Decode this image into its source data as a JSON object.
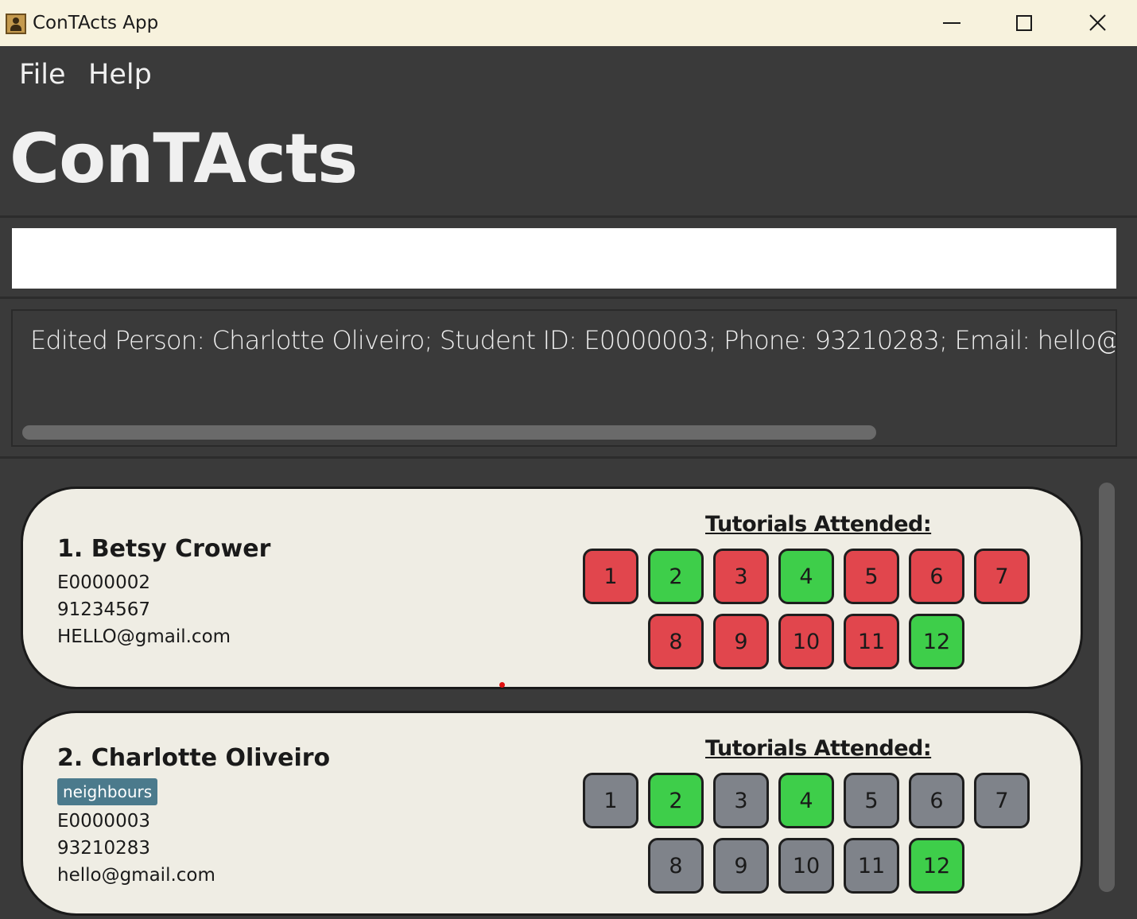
{
  "window": {
    "title": "ConTActs App",
    "controls": {
      "minimize": "minimize-icon",
      "maximize": "maximize-icon",
      "close": "close-icon"
    }
  },
  "menu": {
    "file": "File",
    "help": "Help"
  },
  "heading": "ConTActs",
  "command": {
    "value": "",
    "placeholder": ""
  },
  "result": {
    "text": "Edited Person: Charlotte Oliveiro; Student ID: E0000003; Phone: 93210283; Email: hello@gmail."
  },
  "colors": {
    "attended": "#3ece4a",
    "absent": "#e1464d",
    "unmarked": "#7f838a",
    "tag": "#4b7a8c",
    "card": "#efede4"
  },
  "persons": [
    {
      "name": "1. Betsy Crower",
      "tags": [],
      "student_id": "E0000002",
      "phone": "91234567",
      "email": "HELLO@gmail.com",
      "tutorials_heading": "Tutorials Attended:",
      "tutorials": [
        {
          "label": "1",
          "status": "absent"
        },
        {
          "label": "2",
          "status": "attended"
        },
        {
          "label": "3",
          "status": "absent"
        },
        {
          "label": "4",
          "status": "attended"
        },
        {
          "label": "5",
          "status": "absent"
        },
        {
          "label": "6",
          "status": "absent"
        },
        {
          "label": "7",
          "status": "absent"
        },
        {
          "label": "8",
          "status": "absent"
        },
        {
          "label": "9",
          "status": "absent"
        },
        {
          "label": "10",
          "status": "absent"
        },
        {
          "label": "11",
          "status": "absent"
        },
        {
          "label": "12",
          "status": "attended"
        }
      ]
    },
    {
      "name": "2. Charlotte Oliveiro",
      "tags": [
        "neighbours"
      ],
      "student_id": "E0000003",
      "phone": "93210283",
      "email": "hello@gmail.com",
      "tutorials_heading": "Tutorials Attended:",
      "tutorials": [
        {
          "label": "1",
          "status": "unmarked"
        },
        {
          "label": "2",
          "status": "attended"
        },
        {
          "label": "3",
          "status": "unmarked"
        },
        {
          "label": "4",
          "status": "attended"
        },
        {
          "label": "5",
          "status": "unmarked"
        },
        {
          "label": "6",
          "status": "unmarked"
        },
        {
          "label": "7",
          "status": "unmarked"
        },
        {
          "label": "8",
          "status": "unmarked"
        },
        {
          "label": "9",
          "status": "unmarked"
        },
        {
          "label": "10",
          "status": "unmarked"
        },
        {
          "label": "11",
          "status": "unmarked"
        },
        {
          "label": "12",
          "status": "attended"
        }
      ]
    }
  ]
}
